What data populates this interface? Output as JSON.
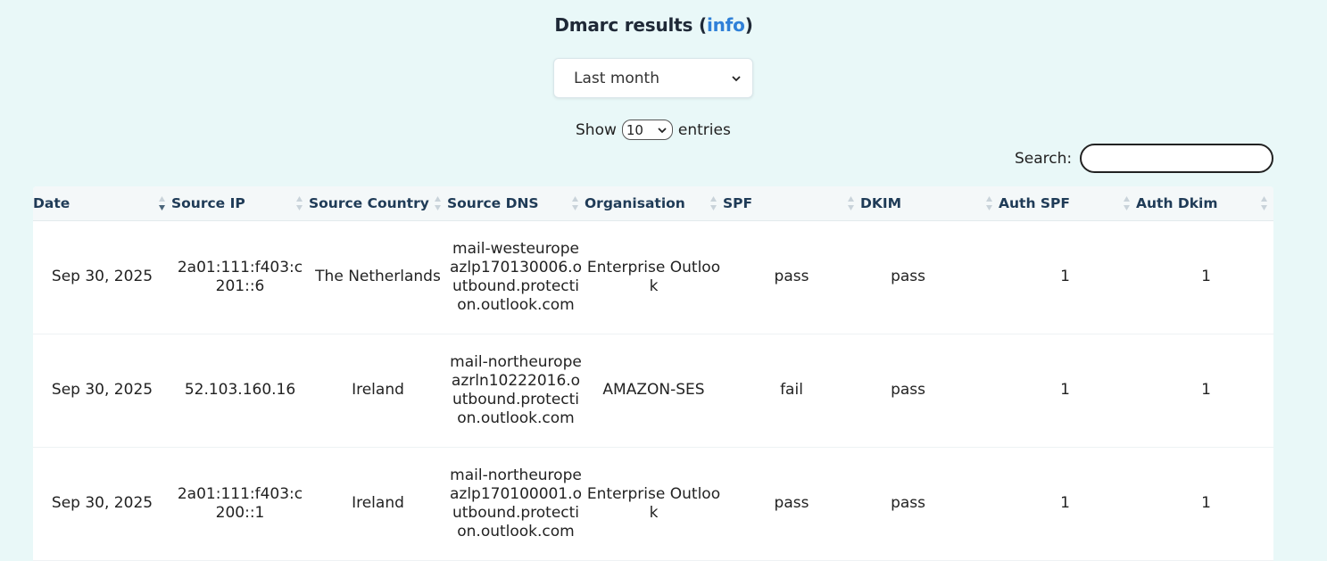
{
  "header": {
    "title": "Dmarc results (",
    "info_link": "info",
    "title_close": ")"
  },
  "period_select": {
    "selected": "Last month"
  },
  "length_control": {
    "prefix": "Show",
    "selected": "10",
    "suffix": "entries"
  },
  "search": {
    "label": "Search:",
    "value": ""
  },
  "table": {
    "columns": [
      "Date",
      "Source IP",
      "Source Country",
      "Source DNS",
      "Organisation",
      "SPF",
      "DKIM",
      "Auth SPF",
      "Auth Dkim"
    ],
    "sorted_column": "Date",
    "rows": [
      {
        "date": "Sep 30, 2025",
        "source_ip": "2a01:111:f403:c201::6",
        "source_country": "The Netherlands",
        "source_dns": "mail-westeuropeazlp170130006.outbound.protection.outlook.com",
        "organisation": "Enterprise Outlook",
        "spf": "pass",
        "dkim": "pass",
        "auth_spf": "1",
        "auth_dkim": "1"
      },
      {
        "date": "Sep 30, 2025",
        "source_ip": "52.103.160.16",
        "source_country": "Ireland",
        "source_dns": "mail-northeuropeazrln10222016.outbound.protection.outlook.com",
        "organisation": "AMAZON-SES",
        "spf": "fail",
        "dkim": "pass",
        "auth_spf": "1",
        "auth_dkim": "1"
      },
      {
        "date": "Sep 30, 2025",
        "source_ip": "2a01:111:f403:c200::1",
        "source_country": "Ireland",
        "source_dns": "mail-northeuropeazlp170100001.outbound.protection.outlook.com",
        "organisation": "Enterprise Outlook",
        "spf": "pass",
        "dkim": "pass",
        "auth_spf": "1",
        "auth_dkim": "1"
      }
    ]
  },
  "icons": {
    "sort": "sort-arrows-icon",
    "dropdown": "chevron-down-icon"
  }
}
